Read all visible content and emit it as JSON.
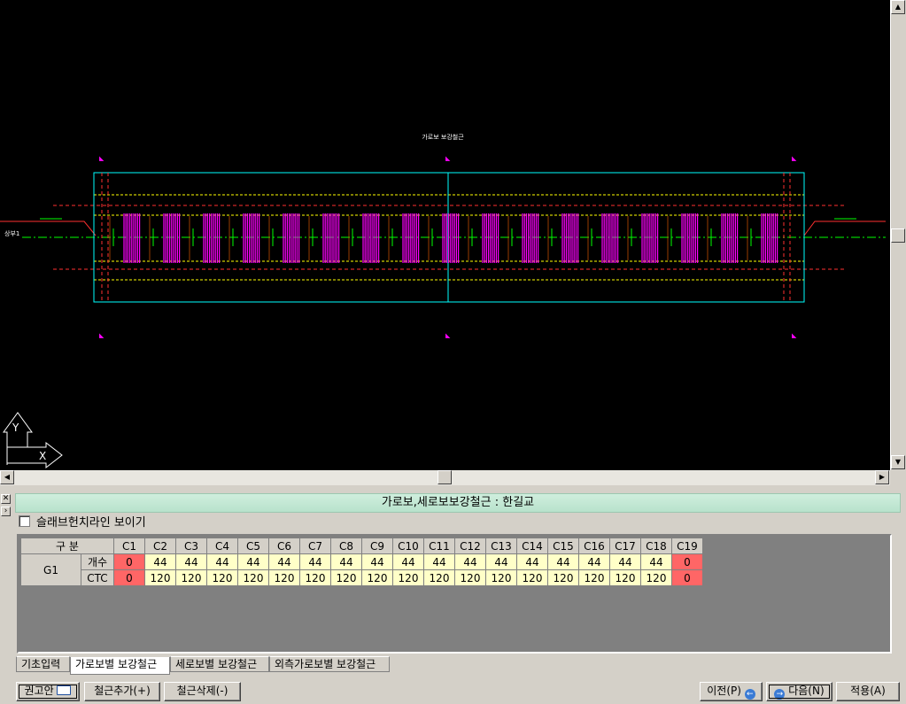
{
  "drawing": {
    "title": "가로보 보강철근",
    "section_label": "상부1",
    "ucs_y": "Y",
    "ucs_x": "X"
  },
  "panel": {
    "title": "가로보,세로보보강철근 : 한길교",
    "checkbox_label": "슬래브헌치라인 보이기",
    "checkbox_checked": false
  },
  "grid": {
    "corner_header": "구 분",
    "columns": [
      "C1",
      "C2",
      "C3",
      "C4",
      "C5",
      "C6",
      "C7",
      "C8",
      "C9",
      "C10",
      "C11",
      "C12",
      "C13",
      "C14",
      "C15",
      "C16",
      "C17",
      "C18",
      "C19"
    ],
    "group": "G1",
    "rows": [
      {
        "label": "개수",
        "values": [
          "0",
          "44",
          "44",
          "44",
          "44",
          "44",
          "44",
          "44",
          "44",
          "44",
          "44",
          "44",
          "44",
          "44",
          "44",
          "44",
          "44",
          "44",
          "0"
        ]
      },
      {
        "label": "CTC",
        "values": [
          "0",
          "120",
          "120",
          "120",
          "120",
          "120",
          "120",
          "120",
          "120",
          "120",
          "120",
          "120",
          "120",
          "120",
          "120",
          "120",
          "120",
          "120",
          "0"
        ]
      }
    ],
    "highlight_color": "#ff6666",
    "value_color": "#ffffc8"
  },
  "tabs": [
    {
      "label": "기초입력",
      "active": false
    },
    {
      "label": "가로보별 보강철근",
      "active": true
    },
    {
      "label": "세로보별 보강철근",
      "active": false
    },
    {
      "label": "외측가로보별 보강철근",
      "active": false
    }
  ],
  "buttons": {
    "recommend": "권고안",
    "add_rebar": "철근추가(+)",
    "delete_rebar": "철근삭제(-)",
    "prev": "이전(P)",
    "next": "다음(N)",
    "apply": "적용(A)"
  },
  "icons": {
    "recommend": "book-icon",
    "prev": "arrow-left-circle-icon",
    "next": "arrow-right-circle-icon"
  }
}
